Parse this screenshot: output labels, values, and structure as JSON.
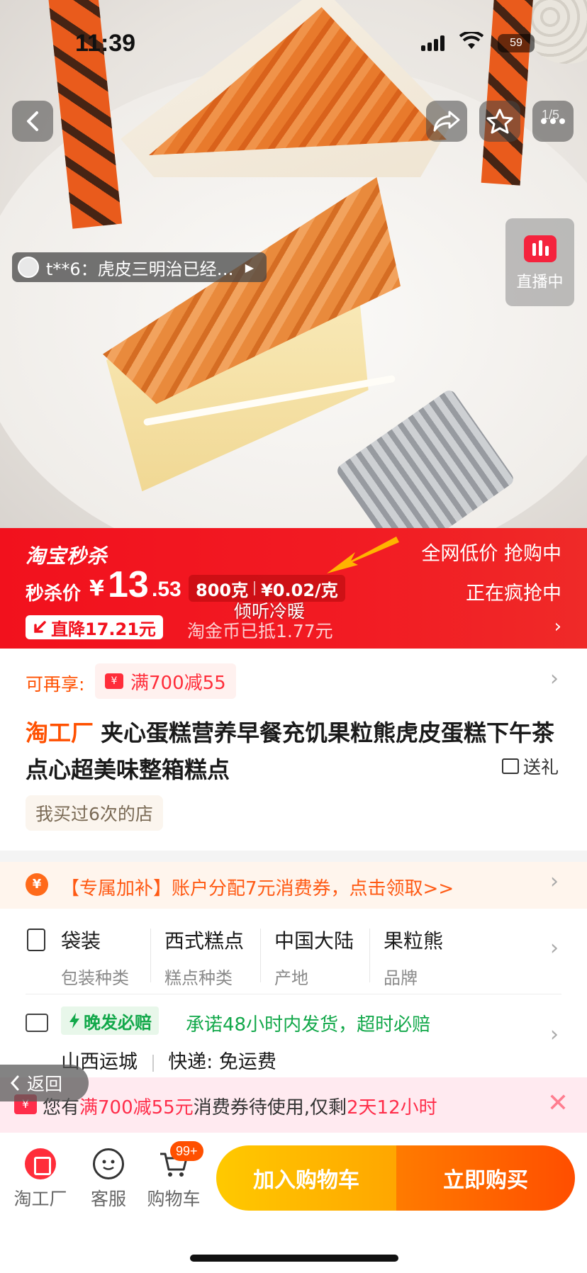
{
  "status_bar": {
    "time": "11:39",
    "battery": "59"
  },
  "hero": {
    "page_indicator": "1/5",
    "comment_preview": "t**6：虎皮三明治已经…",
    "live_label": "直播中"
  },
  "promo": {
    "brand": "淘宝秒杀",
    "price_label": "秒杀价",
    "currency": "¥",
    "price_int": "13",
    "price_dec": ".53",
    "net_weight": "800克",
    "unit_price": "¥0.02/克",
    "tagline_top": "全网低价 抢购中",
    "tagline_bottom": "正在疯抢中",
    "price_drop": "直降17.21元",
    "coin_deduct": "淘金币已抵1.77元",
    "overlay_caption": "倾听冷暖"
  },
  "coupon": {
    "lead": "可再享:",
    "chip": "满700减55"
  },
  "product": {
    "brand": "淘工厂",
    "title": "夹心蛋糕营养早餐充饥果粒熊虎皮蛋糕下午茶点心超美味整箱糕点",
    "gift": "送礼",
    "shop_tag": "我买过6次的店"
  },
  "subsidy": {
    "text": "【专属加补】账户分配7元消费券，点击领取>>"
  },
  "attributes": [
    {
      "value": "袋装",
      "key": "包装种类"
    },
    {
      "value": "西式糕点",
      "key": "糕点种类"
    },
    {
      "value": "中国大陆",
      "key": "产地"
    },
    {
      "value": "果粒熊",
      "key": "品牌"
    }
  ],
  "shipping": {
    "badge": "晚发必赔",
    "promise": "承诺48小时内发货，超时必赔",
    "origin": "山西运城",
    "express": "快递: 免运费"
  },
  "return_label": "返回",
  "notice": {
    "pre": "您有",
    "coupon": "满700减55元",
    "mid": "消费券待使用,仅剩",
    "time_left": "2天12小时"
  },
  "bottom_bar": {
    "tabs": [
      "淘工厂",
      "客服",
      "购物车"
    ],
    "cart_badge": "99+",
    "add_to_cart": "加入购物车",
    "buy_now": "立即购买"
  },
  "colors": {
    "promo_red": "#f2111d",
    "accent_orange": "#ff5000",
    "cart_yellow": "#ffc900",
    "buy_orange": "#ff4e00"
  }
}
